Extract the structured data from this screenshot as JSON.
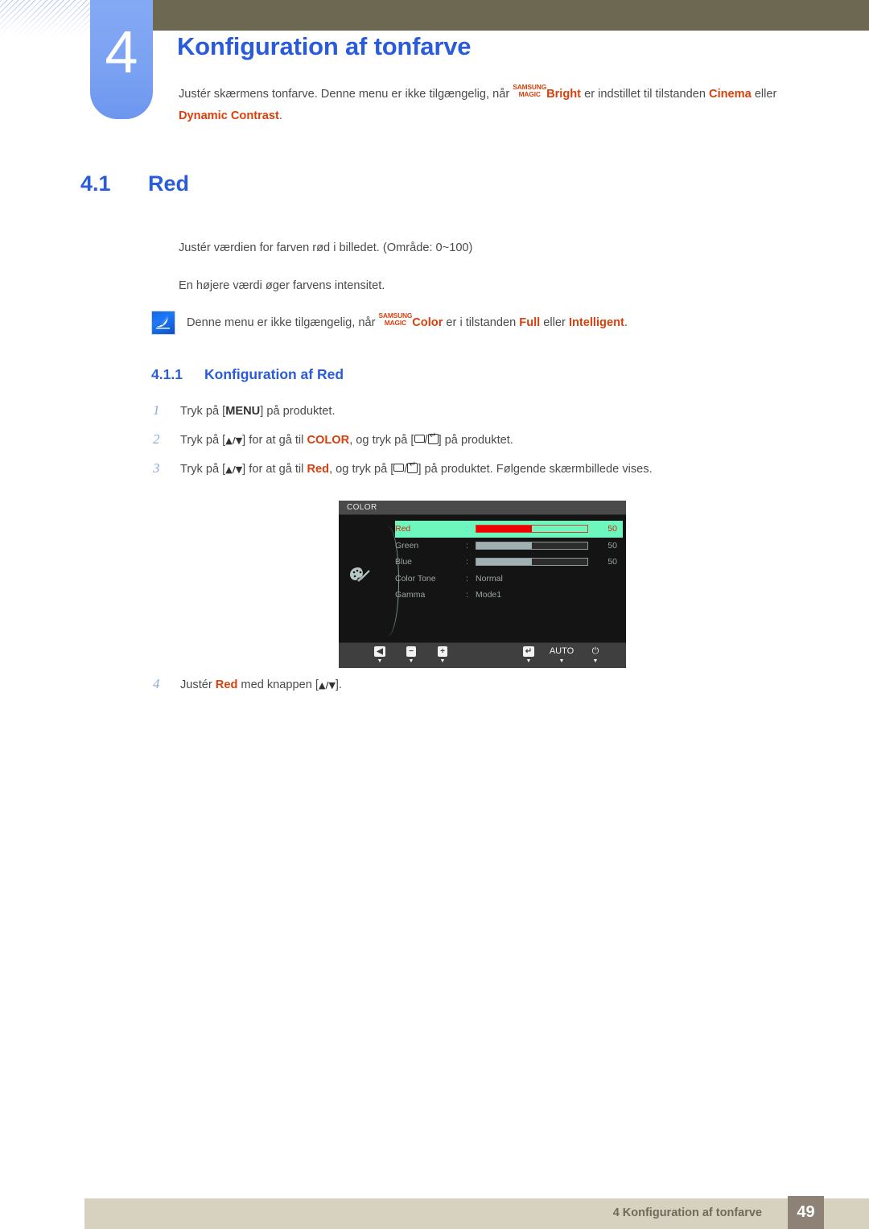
{
  "header": {
    "chapter_number": "4",
    "chapter_title": "Konfiguration af tonfarve",
    "intro_1": "Justér skærmens tonfarve. Denne menu er ikke tilgængelig, når ",
    "intro_magic_top": "SAMSUNG",
    "intro_magic_bottom": "MAGIC",
    "intro_bright": "Bright",
    "intro_2": " er indstillet til tilstanden ",
    "intro_cinema": "Cinema",
    "intro_3": " eller ",
    "intro_dynamic": "Dynamic Contrast",
    "intro_4": "."
  },
  "section": {
    "number": "4.1",
    "title": "Red",
    "paragraph_1": "Justér værdien for farven rød i billedet. (Område: 0~100)",
    "paragraph_2": "En højere værdi øger farvens intensitet."
  },
  "note": {
    "icon": "samsung-note-icon",
    "text_1": "Denne menu er ikke tilgængelig, når ",
    "magic_top": "SAMSUNG",
    "magic_bottom": "MAGIC",
    "color_word": "Color",
    "text_2": " er i tilstanden ",
    "full": "Full",
    "text_3": " eller ",
    "intelligent": "Intelligent",
    "text_4": "."
  },
  "subsection": {
    "number": "4.1.1",
    "title": "Konfiguration af Red"
  },
  "steps": [
    {
      "number": "1",
      "t1": "Tryk på [",
      "kbd": "MENU",
      "t2": "] på produktet."
    },
    {
      "number": "2",
      "t1": "Tryk på [",
      "arrows": "▲/▼",
      "t2": "] for at gå til ",
      "em": "COLOR",
      "t3": ", og tryk på [",
      "t4": "] på produktet."
    },
    {
      "number": "3",
      "t1": "Tryk på [",
      "arrows": "▲/▼",
      "t2": "] for at gå til ",
      "em": "Red",
      "t3": ", og tryk på [",
      "t4": "] på produktet. Følgende skærmbillede vises."
    }
  ],
  "step4": {
    "number": "4",
    "t1": "Justér ",
    "em": "Red",
    "t2": " med knappen [",
    "arrows": "▲/▼",
    "t3": "]."
  },
  "osd": {
    "title": "COLOR",
    "menu_icon": "color-palette-icon",
    "rows": [
      {
        "label": "Red",
        "colon": ":",
        "type": "slider",
        "value": "50",
        "percent": 50,
        "selected": true
      },
      {
        "label": "Green",
        "colon": ":",
        "type": "slider",
        "value": "50",
        "percent": 50,
        "selected": false
      },
      {
        "label": "Blue",
        "colon": ":",
        "type": "slider",
        "value": "50",
        "percent": 50,
        "selected": false
      },
      {
        "label": "Color Tone",
        "colon": ":",
        "type": "value",
        "value": "Normal",
        "selected": false
      },
      {
        "label": "Gamma",
        "colon": ":",
        "type": "value",
        "value": "Mode1",
        "selected": false
      }
    ],
    "footer_buttons": [
      {
        "icon": "left-arrow-icon",
        "glyph": "◀",
        "label": "",
        "sub": "▼"
      },
      {
        "icon": "minus-icon",
        "glyph": "−",
        "label": "",
        "sub": "▼"
      },
      {
        "icon": "plus-icon",
        "glyph": "+",
        "label": "",
        "sub": "▼"
      },
      {
        "icon": "enter-icon",
        "glyph": "↵",
        "label": "",
        "sub": "▼"
      },
      {
        "icon": "auto-icon",
        "glyph": "",
        "label": "AUTO",
        "sub": "▼"
      },
      {
        "icon": "power-icon",
        "glyph": "⏻",
        "label": "",
        "sub": "▼"
      }
    ],
    "highlight_color": "#6df7be",
    "bar_fill_color": "#f00000"
  },
  "footer": {
    "text": "4 Konfiguration af tonfarve",
    "page_number": "49"
  }
}
